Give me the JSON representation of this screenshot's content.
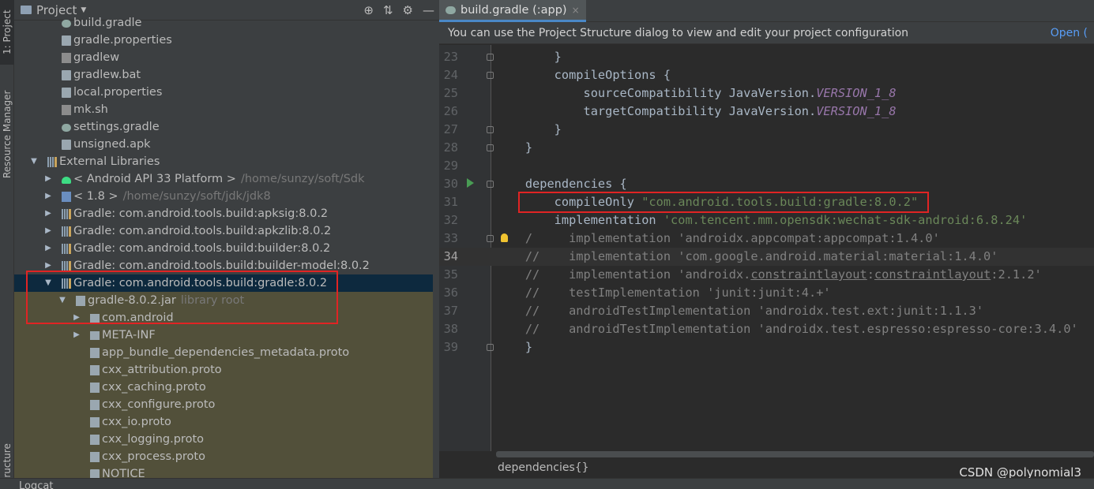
{
  "left_stripe": {
    "project_tab": "1: Project",
    "resource_tab": "Resource Manager",
    "structure_tab": "Structure"
  },
  "project_panel": {
    "title": "Project",
    "tools": [
      "target-icon",
      "collapse-icon",
      "gear-icon",
      "minimize-icon"
    ],
    "tree": [
      {
        "label": "build.gradle",
        "extra": "",
        "icon": "gradle-icon",
        "arrow": "",
        "indent": 1
      },
      {
        "label": "gradle.properties",
        "extra": "",
        "icon": "properties-file-icon",
        "arrow": "",
        "indent": 1
      },
      {
        "label": "gradlew",
        "extra": "",
        "icon": "shell-script-icon",
        "arrow": "",
        "indent": 1
      },
      {
        "label": "gradlew.bat",
        "extra": "",
        "icon": "file-icon",
        "arrow": "",
        "indent": 1
      },
      {
        "label": "local.properties",
        "extra": "",
        "icon": "properties-file-icon",
        "arrow": "",
        "indent": 1
      },
      {
        "label": "mk.sh",
        "extra": "",
        "icon": "shell-script-icon",
        "arrow": "",
        "indent": 1
      },
      {
        "label": "settings.gradle",
        "extra": "",
        "icon": "gradle-icon",
        "arrow": "",
        "indent": 1
      },
      {
        "label": "unsigned.apk",
        "extra": "",
        "icon": "file-icon",
        "arrow": "",
        "indent": 1
      },
      {
        "label": "External Libraries",
        "extra": "",
        "icon": "library-icon",
        "arrow": "expanded",
        "indent": 0
      },
      {
        "label": "< Android API 33 Platform >",
        "extra": "/home/sunzy/soft/Sdk",
        "icon": "android-icon",
        "arrow": "collapsed",
        "indent": 1
      },
      {
        "label": "< 1.8 >",
        "extra": "/home/sunzy/soft/jdk/jdk8",
        "icon": "jdk-icon",
        "arrow": "collapsed",
        "indent": 1
      },
      {
        "label": "Gradle: com.android.tools.build:apksig:8.0.2",
        "extra": "",
        "icon": "library-icon",
        "arrow": "collapsed",
        "indent": 1
      },
      {
        "label": "Gradle: com.android.tools.build:apkzlib:8.0.2",
        "extra": "",
        "icon": "library-icon",
        "arrow": "collapsed",
        "indent": 1
      },
      {
        "label": "Gradle: com.android.tools.build:builder:8.0.2",
        "extra": "",
        "icon": "library-icon",
        "arrow": "collapsed",
        "indent": 1
      },
      {
        "label": "Gradle: com.android.tools.build:builder-model:8.0.2",
        "extra": "",
        "icon": "library-icon",
        "arrow": "collapsed",
        "indent": 1
      },
      {
        "label": "Gradle: com.android.tools.build:gradle:8.0.2",
        "extra": "",
        "icon": "library-icon",
        "arrow": "expanded",
        "indent": 1,
        "selected": true
      },
      {
        "label": "gradle-8.0.2.jar",
        "extra": "library root",
        "icon": "jar-icon",
        "arrow": "expanded",
        "indent": 2
      },
      {
        "label": "com.android",
        "extra": "",
        "icon": "package-icon",
        "arrow": "collapsed",
        "indent": 3
      },
      {
        "label": "META-INF",
        "extra": "",
        "icon": "package-icon",
        "arrow": "collapsed",
        "indent": 3
      },
      {
        "label": "app_bundle_dependencies_metadata.proto",
        "extra": "",
        "icon": "proto-file-icon",
        "arrow": "",
        "indent": 3
      },
      {
        "label": "cxx_attribution.proto",
        "extra": "",
        "icon": "proto-file-icon",
        "arrow": "",
        "indent": 3
      },
      {
        "label": "cxx_caching.proto",
        "extra": "",
        "icon": "proto-file-icon",
        "arrow": "",
        "indent": 3
      },
      {
        "label": "cxx_configure.proto",
        "extra": "",
        "icon": "proto-file-icon",
        "arrow": "",
        "indent": 3
      },
      {
        "label": "cxx_io.proto",
        "extra": "",
        "icon": "proto-file-icon",
        "arrow": "",
        "indent": 3
      },
      {
        "label": "cxx_logging.proto",
        "extra": "",
        "icon": "proto-file-icon",
        "arrow": "",
        "indent": 3
      },
      {
        "label": "cxx_process.proto",
        "extra": "",
        "icon": "proto-file-icon",
        "arrow": "",
        "indent": 3
      },
      {
        "label": "NOTICE",
        "extra": "",
        "icon": "file-icon",
        "arrow": "",
        "indent": 3
      }
    ]
  },
  "editor": {
    "tab_label": "build.gradle (:app)",
    "tab_close": "×",
    "banner_text": "You can use the Project Structure dialog to view and edit your project configuration",
    "banner_link": "Open (",
    "current_line": "34",
    "lines": [
      {
        "n": "23",
        "parts": [
          [
            "kw",
            "        }"
          ]
        ]
      },
      {
        "n": "24",
        "parts": [
          [
            "kw",
            "        compileOptions {"
          ]
        ]
      },
      {
        "n": "25",
        "parts": [
          [
            "kw",
            "            sourceCompatibility JavaVersion."
          ],
          [
            "const",
            "VERSION_1_8"
          ]
        ]
      },
      {
        "n": "26",
        "parts": [
          [
            "kw",
            "            targetCompatibility JavaVersion."
          ],
          [
            "const",
            "VERSION_1_8"
          ]
        ]
      },
      {
        "n": "27",
        "parts": [
          [
            "kw",
            "        }"
          ]
        ]
      },
      {
        "n": "28",
        "parts": [
          [
            "kw",
            "    }"
          ]
        ]
      },
      {
        "n": "29",
        "parts": [
          [
            "kw",
            ""
          ]
        ]
      },
      {
        "n": "30",
        "parts": [
          [
            "kw",
            "    dependencies {"
          ]
        ]
      },
      {
        "n": "31",
        "parts": [
          [
            "kw",
            "        compileOnly "
          ],
          [
            "str",
            "\"com.android.tools.build:gradle:8.0.2\""
          ]
        ]
      },
      {
        "n": "32",
        "parts": [
          [
            "kw",
            "        implementation "
          ],
          [
            "str",
            "'com.tencent.mm.opensdk:wechat-sdk-android:6.8.24'"
          ]
        ]
      },
      {
        "n": "33",
        "parts": [
          [
            "cmt",
            "    /     implementation 'androidx.appcompat:appcompat:1.4.0'"
          ]
        ]
      },
      {
        "n": "34",
        "parts": [
          [
            "cmt",
            "    //    implementation 'com.google.android.material:material:1.4.0'"
          ]
        ]
      },
      {
        "n": "35",
        "parts": [
          [
            "cmt",
            "    //    implementation 'androidx."
          ],
          [
            "und",
            "constraintlayout"
          ],
          [
            "cmt",
            ":"
          ],
          [
            "und",
            "constraintlayout"
          ],
          [
            "cmt",
            ":2.1.2'"
          ]
        ]
      },
      {
        "n": "36",
        "parts": [
          [
            "cmt",
            "    //    testImplementation 'junit:junit:4.+'"
          ]
        ]
      },
      {
        "n": "37",
        "parts": [
          [
            "cmt",
            "    //    androidTestImplementation 'androidx.test.ext:junit:1.1.3'"
          ]
        ]
      },
      {
        "n": "38",
        "parts": [
          [
            "cmt",
            "    //    androidTestImplementation 'androidx.test.espresso:espresso-core:3.4.0'"
          ]
        ]
      },
      {
        "n": "39",
        "parts": [
          [
            "kw",
            "    }"
          ]
        ]
      }
    ],
    "breadcrumb": "dependencies{}"
  },
  "watermark": "CSDN @polynomial3",
  "bottom_bar_label": "Logcat",
  "colors": {
    "selection": "#0d293e",
    "library_root_bg": "#52503a",
    "highlight_box": "#e02424",
    "string": "#6a8759",
    "constant": "#9876aa",
    "comment": "#808080"
  }
}
